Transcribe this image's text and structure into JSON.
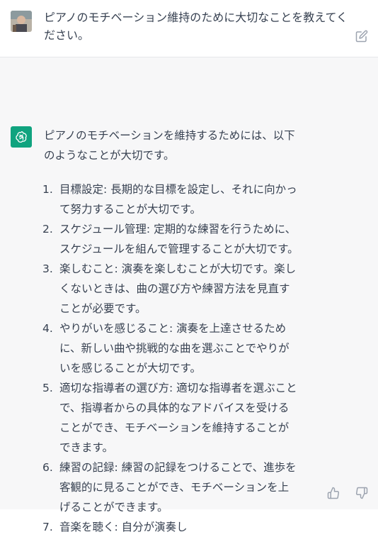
{
  "user_message": {
    "text": "ピアノのモチベーション維持のために大切なことを教えてください。"
  },
  "assistant_message": {
    "intro": "ピアノのモチベーションを維持するためには、以下のようなことが大切です。",
    "items": [
      {
        "num": "1.",
        "text": "目標設定: 長期的な目標を設定し、それに向かって努力することが大切です。"
      },
      {
        "num": "2.",
        "text": "スケジュール管理: 定期的な練習を行うために、スケジュールを組んで管理することが大切です。"
      },
      {
        "num": "3.",
        "text": "楽しむこと: 演奏を楽しむことが大切です。楽しくないときは、曲の選び方や練習方法を見直すことが必要です。"
      },
      {
        "num": "4.",
        "text": "やりがいを感じること: 演奏を上達させるために、新しい曲や挑戦的な曲を選ぶことでやりがいを感じることが大切です。"
      },
      {
        "num": "5.",
        "text": "適切な指導者の選び方: 適切な指導者を選ぶことで、指導者からの具体的なアドバイスを受けることができ、モチベーションを維持することができます。"
      },
      {
        "num": "6.",
        "text": "練習の記録: 練習の記録をつけることで、進歩を客観的に見ることができ、モチベーションを上げることができます。"
      },
      {
        "num": "7.",
        "text": "音楽を聴く: 自分が演奏し"
      }
    ]
  },
  "colors": {
    "accent": "#10a37f",
    "assistant_bg": "#f7f7f8",
    "text": "#374151",
    "icon": "#9ca3af"
  }
}
